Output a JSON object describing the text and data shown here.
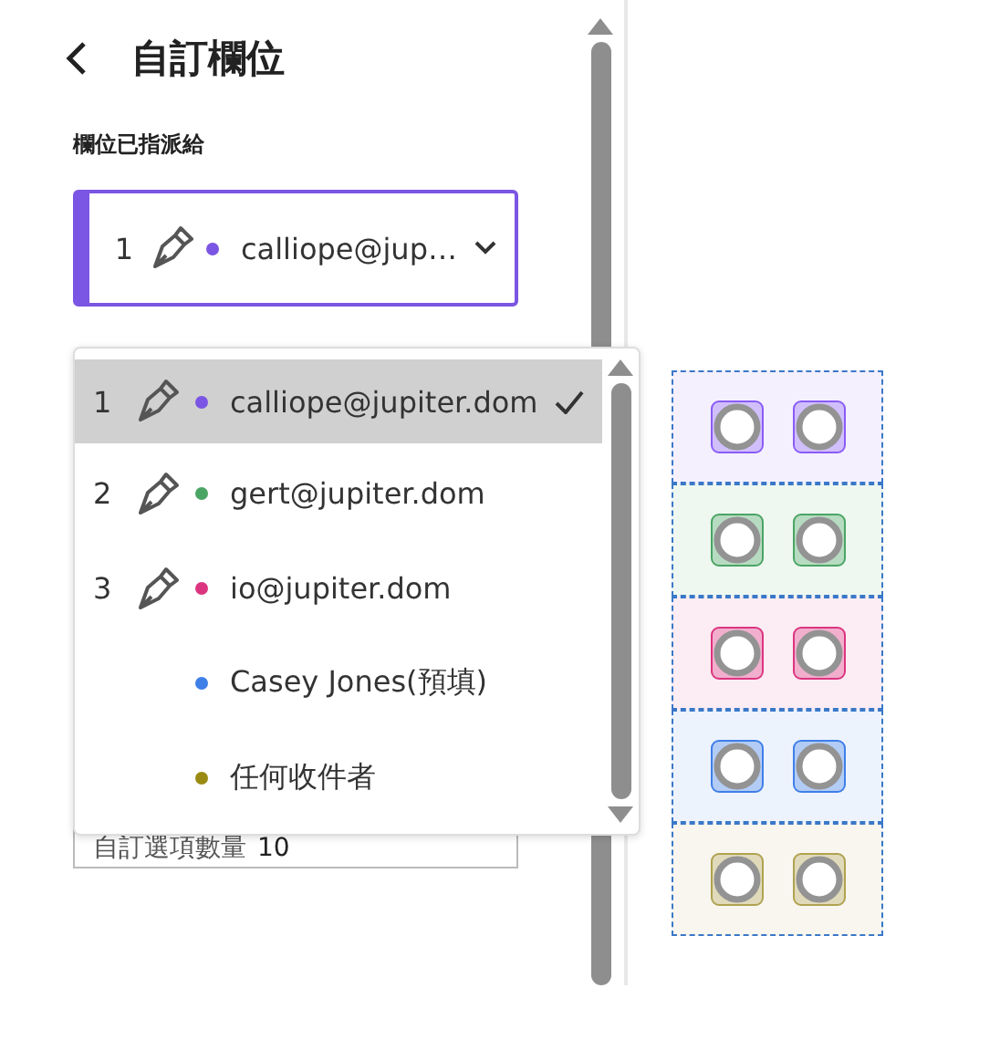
{
  "header": {
    "title": "自訂欄位"
  },
  "assigned_label": "欄位已指派給",
  "select": {
    "number": "1",
    "color": "#7b55e3",
    "value": "calliope@jup…"
  },
  "behind_field": {
    "label": "自訂選項數量",
    "value": "10"
  },
  "menu": [
    {
      "kind": "signer",
      "number": "1",
      "color": "#7b55e3",
      "label": "calliope@jupiter.dom",
      "selected": true
    },
    {
      "kind": "signer",
      "number": "2",
      "color": "#4aa564",
      "label": "gert@jupiter.dom",
      "selected": false
    },
    {
      "kind": "signer",
      "number": "3",
      "color": "#dc3580",
      "label": "io@jupiter.dom",
      "selected": false
    },
    {
      "kind": "plain",
      "color": "#3f7fe8",
      "label": "Casey Jones(預填)",
      "selected": false
    },
    {
      "kind": "plain",
      "color": "#9a8a12",
      "label": "任何收件者",
      "selected": false
    }
  ],
  "canvas_rows": [
    {
      "color": "#8b5cf6"
    },
    {
      "color": "#4aa564"
    },
    {
      "color": "#dc3580"
    },
    {
      "color": "#3f7fe8"
    },
    {
      "color": "#b0a250"
    }
  ]
}
